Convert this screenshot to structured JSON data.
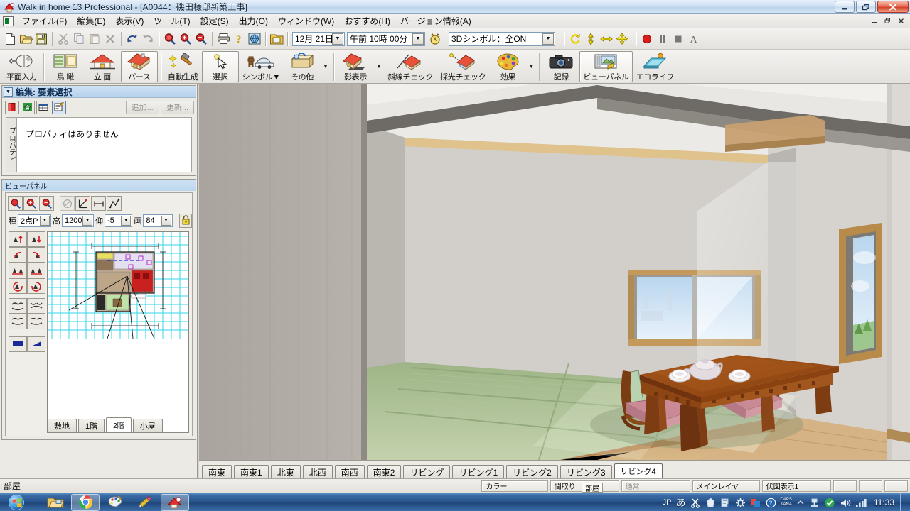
{
  "window": {
    "title": "Walk in home 13 Professional - [A0044：磯田様邸新築工事]",
    "icon": "app-icon",
    "buttons": {
      "minimize": "—",
      "restore": "❐",
      "close": "✕"
    },
    "mdi_buttons": {
      "minimize": "_",
      "restore": "❐",
      "close": "✕"
    }
  },
  "menu": {
    "items": [
      {
        "label": "ファイル(F)"
      },
      {
        "label": "編集(E)"
      },
      {
        "label": "表示(V)"
      },
      {
        "label": "ツール(T)"
      },
      {
        "label": "設定(S)"
      },
      {
        "label": "出力(O)"
      },
      {
        "label": "ウィンドウ(W)"
      },
      {
        "label": "おすすめ(H)"
      },
      {
        "label": "バージョン情報(A)"
      }
    ]
  },
  "toolbar_small": {
    "icons": [
      "new-file-icon",
      "open-folder-icon",
      "save-disk-icon",
      "cut-scissors-icon",
      "copy-icon",
      "paste-icon",
      "delete-x-icon",
      "undo-icon",
      "redo-icon",
      "zoom-fit-icon",
      "zoom-in-icon",
      "zoom-out-icon",
      "print-icon",
      "help-icon",
      "globe-icon",
      "open-project-icon"
    ],
    "date_value": "12月 21日",
    "time_value": "午前 10時 00分",
    "clock_icon": "alarm-clock-icon",
    "symbol_value": "3Dシンボル：全ON",
    "nav_icons": [
      "rotate-icon",
      "walk-icon",
      "pan-icon",
      "move-icon"
    ],
    "record_icons": [
      "record-dot-icon",
      "pause-icon",
      "stop-icon",
      "text-a-icon"
    ]
  },
  "toolbar_big": {
    "buttons": [
      {
        "label": "平面入力",
        "icon": "mouse-plan-icon",
        "selected": false
      },
      {
        "label": "鳥 瞰",
        "icon": "birdview-icon",
        "selected": false
      },
      {
        "label": "立 面",
        "icon": "elevation-house-icon",
        "selected": false
      },
      {
        "label": "パース",
        "icon": "perspective-house-icon",
        "selected": true
      },
      {
        "label": "自動生成",
        "icon": "auto-generate-hammer-icon",
        "selected": false
      },
      {
        "label": "選択",
        "icon": "cursor-select-icon",
        "selected": true
      },
      {
        "label": "シンボル▼",
        "icon": "symbol-furniture-icon",
        "selected": false
      },
      {
        "label": "その他",
        "icon": "other-box-icon",
        "selected": false
      },
      {
        "label": "影表示",
        "icon": "shadow-house-icon",
        "selected": false
      },
      {
        "label": "斜線チェック",
        "icon": "slantline-check-icon",
        "selected": false
      },
      {
        "label": "採光チェック",
        "icon": "daylight-check-icon",
        "selected": false
      },
      {
        "label": "効果",
        "icon": "effect-palette-icon",
        "selected": false
      },
      {
        "label": "記録",
        "icon": "camera-record-icon",
        "selected": false
      },
      {
        "label": "ビューパネル",
        "icon": "view-panel-icon",
        "selected": true
      },
      {
        "label": "エコライフ",
        "icon": "ecolife-icon",
        "selected": false
      }
    ]
  },
  "edit_panel": {
    "title": "編集: 要素選択",
    "collapse_icon": "collapse-arrow-icon",
    "tool_icons": [
      "red-block-icon",
      "house-green-icon",
      "list-icon",
      "properties-icon"
    ],
    "add_button": "追加...",
    "update_button": "更新...",
    "vertical_tab": "プロパティ",
    "empty_message": "プロパティはありません"
  },
  "view_panel": {
    "title": "ビューパネル",
    "tool_icons": [
      "zoom-fit-icon",
      "zoom-in-icon",
      "zoom-out-icon",
      "circle-arrow-icon",
      "two-point-perspective-icon",
      "distance-icon",
      "path-icon"
    ],
    "fields": [
      {
        "label": "種",
        "value": "2点P"
      },
      {
        "label": "高",
        "value": "1200"
      },
      {
        "label": "仰",
        "value": "-5"
      },
      {
        "label": "画",
        "value": "84"
      }
    ],
    "lock_icon": "lock-icon",
    "nav_icons": [
      "move-up-icon",
      "move-down-icon",
      "turn-left-icon",
      "turn-right-icon",
      "strafe-left-icon",
      "strafe-right-icon",
      "rotate-left-icon",
      "rotate-right-icon",
      "look-up-icon",
      "look-down-icon",
      "tilt-left-icon",
      "tilt-right-icon"
    ],
    "mode_icons": [
      "fill-mode-icon",
      "wire-mode-icon"
    ],
    "floor_tabs": [
      {
        "label": "敷地",
        "selected": false
      },
      {
        "label": "1階",
        "selected": false
      },
      {
        "label": "2階",
        "selected": true
      },
      {
        "label": "小屋",
        "selected": false
      }
    ]
  },
  "view_tabs": [
    {
      "label": "南東",
      "selected": false
    },
    {
      "label": "南東1",
      "selected": false
    },
    {
      "label": "北東",
      "selected": false
    },
    {
      "label": "北西",
      "selected": false
    },
    {
      "label": "南西",
      "selected": false
    },
    {
      "label": "南東2",
      "selected": false
    },
    {
      "label": "リビング",
      "selected": false
    },
    {
      "label": "リビング1",
      "selected": false
    },
    {
      "label": "リビング2",
      "selected": false
    },
    {
      "label": "リビング3",
      "selected": false
    },
    {
      "label": "リビング4",
      "selected": true
    }
  ],
  "status_bar": {
    "message": "部屋",
    "cells": [
      {
        "label": "カラー",
        "dim": false
      },
      {
        "label": "間取り",
        "dim": false
      },
      {
        "label": "通常",
        "dim": true
      },
      {
        "label": "メインレイヤ",
        "dim": false
      },
      {
        "label": "伏図表示1",
        "dim": false
      },
      {
        "label": "",
        "dim": false
      },
      {
        "label": "",
        "dim": false
      },
      {
        "label": "",
        "dim": false
      }
    ],
    "tooltip": "部屋"
  },
  "taskbar": {
    "start_icon": "windows-start-orb",
    "items": [
      {
        "icon": "explorer-folder-icon",
        "open": false
      },
      {
        "icon": "chrome-icon",
        "open": true
      },
      {
        "icon": "paint-icon",
        "open": false
      },
      {
        "icon": "pencil-icon",
        "open": false
      },
      {
        "icon": "walkinhome-icon",
        "open": true
      }
    ],
    "tray": {
      "ime_lang": "JP",
      "ime_mode": "あ",
      "icons": [
        "scissors-icon",
        "ime-pad-icon",
        "ime-dict-icon",
        "ime-tool-icon",
        "apps-icon",
        "help-circle-icon"
      ],
      "caps_label": "CAPS",
      "kana_label": "KANA",
      "overflow_icon": "chevron-up-icon",
      "system_icons": [
        "usb-icon",
        "dropbox-icon",
        "volume-icon",
        "network-icon"
      ]
    },
    "clock": "11:33"
  },
  "viewport": {
    "scene_name": "リビング4",
    "description": "tatami-room-perspective"
  },
  "colors": {
    "accent": "#b6d2ec",
    "panel": "#eceae5",
    "taskbar": "#27528a",
    "tatami": "#a8bd8e",
    "wood": "#8b4a17"
  }
}
